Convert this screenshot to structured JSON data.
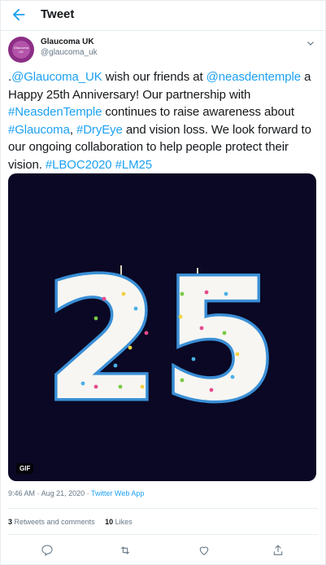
{
  "header": {
    "title": "Tweet"
  },
  "author": {
    "name": "Glaucoma UK",
    "handle": "@glaucoma_uk",
    "avatar_text": "Glaucoma UK"
  },
  "tweet": {
    "parts": [
      {
        "text": ".",
        "link": false
      },
      {
        "text": "@Glaucoma_UK",
        "link": true
      },
      {
        "text": " wish our friends at ",
        "link": false
      },
      {
        "text": "@neasdentemple",
        "link": true
      },
      {
        "text": " a Happy 25th Anniversary! Our partnership with ",
        "link": false
      },
      {
        "text": "#NeasdenTemple",
        "link": true
      },
      {
        "text": " continues to raise awareness about ",
        "link": false
      },
      {
        "text": "#Glaucoma",
        "link": true
      },
      {
        "text": ", ",
        "link": false
      },
      {
        "text": "#DryEye",
        "link": true
      },
      {
        "text": " and vision loss. We look forward to our ongoing collaboration to help people protect their vision. ",
        "link": false
      },
      {
        "text": "#LBOC2020",
        "link": true
      },
      {
        "text": " ",
        "link": false
      },
      {
        "text": "#LM25",
        "link": true
      }
    ],
    "media": {
      "badge": "GIF",
      "number": "25"
    },
    "time": "9:46 AM",
    "date": "Aug 21, 2020",
    "source": "Twitter Web App"
  },
  "stats": {
    "retweets_count": "3",
    "retweets_label": "Retweets and comments",
    "likes_count": "10",
    "likes_label": "Likes"
  },
  "colors": {
    "accent": "#1da1f2",
    "brand": "#8c2e86",
    "media_bg": "#0a0824"
  },
  "icons": [
    "back-arrow-icon",
    "chevron-down-icon",
    "reply-icon",
    "retweet-icon",
    "like-icon",
    "share-icon"
  ]
}
